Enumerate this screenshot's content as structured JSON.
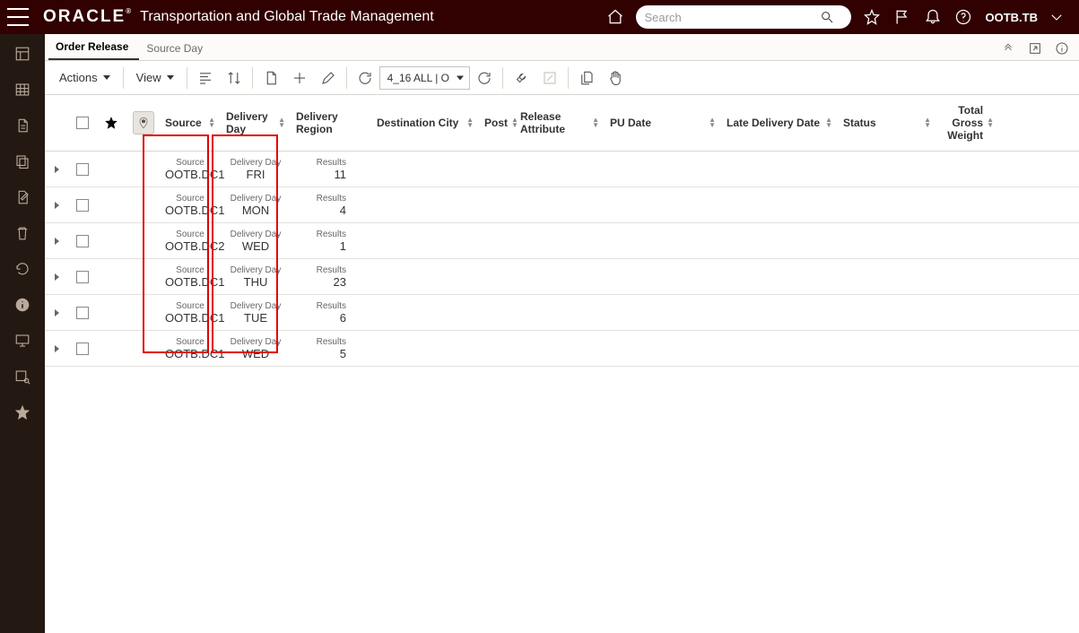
{
  "header": {
    "brand": "ORACLE",
    "app_title": "Transportation and Global Trade Management",
    "search_placeholder": "Search",
    "user": "OOTB.TB"
  },
  "breadcrumb": {
    "items": [
      {
        "label": "Order Release",
        "active": true
      },
      {
        "label": "Source Day",
        "active": false
      }
    ]
  },
  "toolbar": {
    "actions_label": "Actions",
    "view_label": "View",
    "layout_value": "4_16 ALL | O"
  },
  "columns": {
    "source": "Source",
    "delivery_day": "Delivery Day",
    "delivery_region": "Delivery Region",
    "destination_city": "Destination City",
    "post": "Post",
    "release_attribute": "Release Attribute",
    "pu_date": "PU Date",
    "late_delivery_date": "Late Delivery Date",
    "status": "Status",
    "total_gross_weight": "Total Gross Weight"
  },
  "group_labels": {
    "source": "Source",
    "delivery_day": "Delivery Day",
    "results": "Results"
  },
  "rows": [
    {
      "source": "OOTB.DC1",
      "delivery_day": "FRI",
      "results": "11"
    },
    {
      "source": "OOTB.DC1",
      "delivery_day": "MON",
      "results": "4"
    },
    {
      "source": "OOTB.DC2",
      "delivery_day": "WED",
      "results": "1"
    },
    {
      "source": "OOTB.DC1",
      "delivery_day": "THU",
      "results": "23"
    },
    {
      "source": "OOTB.DC1",
      "delivery_day": "TUE",
      "results": "6"
    },
    {
      "source": "OOTB.DC1",
      "delivery_day": "WED",
      "results": "5"
    }
  ]
}
